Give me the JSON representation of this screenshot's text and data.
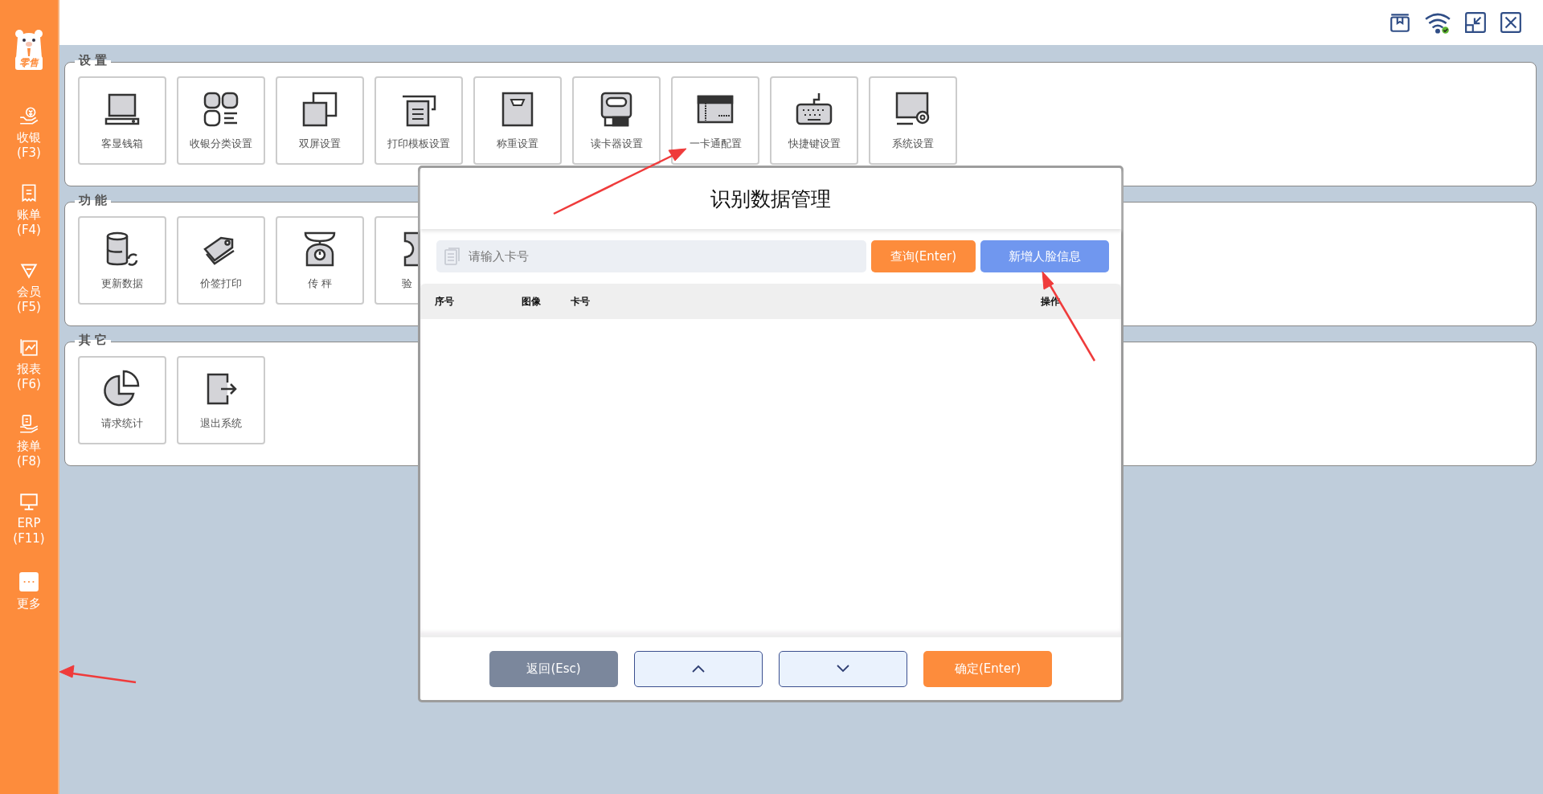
{
  "sidebar": {
    "logo_badge": "零售",
    "items": [
      {
        "kind": "cashier",
        "label": "收银",
        "shortcut": "(F3)"
      },
      {
        "kind": "bill",
        "label": "账单",
        "shortcut": "(F4)"
      },
      {
        "kind": "member",
        "label": "会员",
        "shortcut": "(F5)"
      },
      {
        "kind": "report",
        "label": "报表",
        "shortcut": "(F6)"
      },
      {
        "kind": "order",
        "label": "接单",
        "shortcut": "(F8)"
      },
      {
        "kind": "erp",
        "label": "ERP",
        "shortcut": "(F11)"
      },
      {
        "kind": "more",
        "label": "更多"
      }
    ]
  },
  "sections": [
    {
      "title": "设 置",
      "tiles": [
        {
          "kind": "monitor",
          "label": "客显钱箱"
        },
        {
          "kind": "categories",
          "label": "收银分类设置"
        },
        {
          "kind": "dual",
          "label": "双屏设置"
        },
        {
          "kind": "printer",
          "label": "打印模板设置"
        },
        {
          "kind": "scale-box",
          "label": "称重设置"
        },
        {
          "kind": "reader",
          "label": "读卡器设置"
        },
        {
          "kind": "card",
          "label": "一卡通配置"
        },
        {
          "kind": "keyboard",
          "label": "快捷键设置"
        },
        {
          "kind": "system",
          "label": "系统设置"
        }
      ]
    },
    {
      "title": "功 能",
      "tiles": [
        {
          "kind": "database",
          "label": "更新数据"
        },
        {
          "kind": "tag",
          "label": "价签打印"
        },
        {
          "kind": "scale",
          "label": "传 秤"
        },
        {
          "kind": "ticket",
          "label": "验",
          "clipped": true
        }
      ]
    },
    {
      "title": "其 它",
      "tiles": [
        {
          "kind": "pie",
          "label": "请求统计"
        },
        {
          "kind": "exit",
          "label": "退出系统"
        }
      ]
    }
  ],
  "dialog": {
    "title": "识别数据管理",
    "search": {
      "placeholder": "请输入卡号"
    },
    "search_button": "查询(Enter)",
    "add_button": "新增人脸信息",
    "table": {
      "columns": [
        "序号",
        "图像",
        "卡号",
        "操作"
      ]
    },
    "footer": {
      "back": "返回(Esc)",
      "confirm": "确定(Enter)"
    }
  }
}
